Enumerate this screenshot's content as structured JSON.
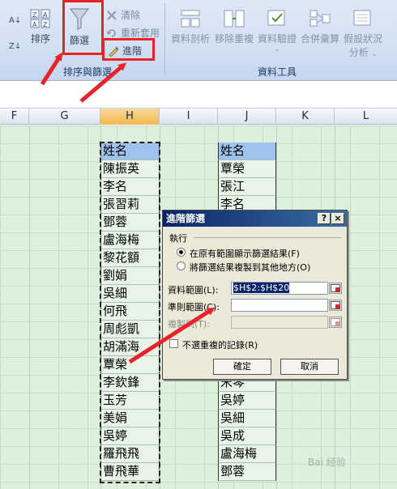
{
  "ribbon": {
    "sort_asc_icon": "sort-ascending-icon",
    "sort_label": "排序",
    "filter_label": "篩選",
    "clear_label": "清除",
    "reapply_label": "重新套用",
    "advanced_label": "進階",
    "sort_filter_group": "排序與篩選",
    "text_to_columns": "資料剖析",
    "remove_duplicates": "移除重複",
    "data_validation": "資料驗證",
    "consolidate": "合併彙算",
    "what_if": "假設狀況",
    "what_if_line2": "分析",
    "data_tools_group": "資料工具"
  },
  "columns": [
    "F",
    "G",
    "H",
    "I",
    "J",
    "K",
    "L"
  ],
  "selected_column": "H",
  "column_h": [
    "姓名",
    "陳振英",
    "李名",
    "張習莉",
    "鄧蓉",
    "盧海梅",
    "黎花額",
    "劉娟",
    "吳細",
    "何飛",
    "周彪凱",
    "胡滿海",
    "覃榮",
    "李欽鋒",
    "玉芳",
    "美娟",
    "吳婷",
    "羅飛飛",
    "曹飛華"
  ],
  "column_j_top": [
    "姓名",
    "覃榮",
    "張江",
    "李名"
  ],
  "column_j_bottom": [
    "宋琴",
    "吳婷",
    "吳細",
    "吳成",
    "盧海梅",
    "鄧蓉"
  ],
  "dialog": {
    "title": "進階篩選",
    "help_btn": "?",
    "close_btn": "×",
    "action_label": "執行",
    "option_inplace": "在原有範圍顯示篩選結果(F)",
    "option_copy": "將篩選結果複製到其他地方(O)",
    "list_range_label": "資料範圍(L):",
    "list_range_value": "$H$2:$H$20",
    "criteria_range_label": "準則範圍(C):",
    "criteria_range_value": "",
    "copy_to_label": "複製到(T):",
    "unique_label": "不選重複的記錄(R)",
    "ok_label": "確定",
    "cancel_label": "取消"
  },
  "watermark": "Bai 经验"
}
